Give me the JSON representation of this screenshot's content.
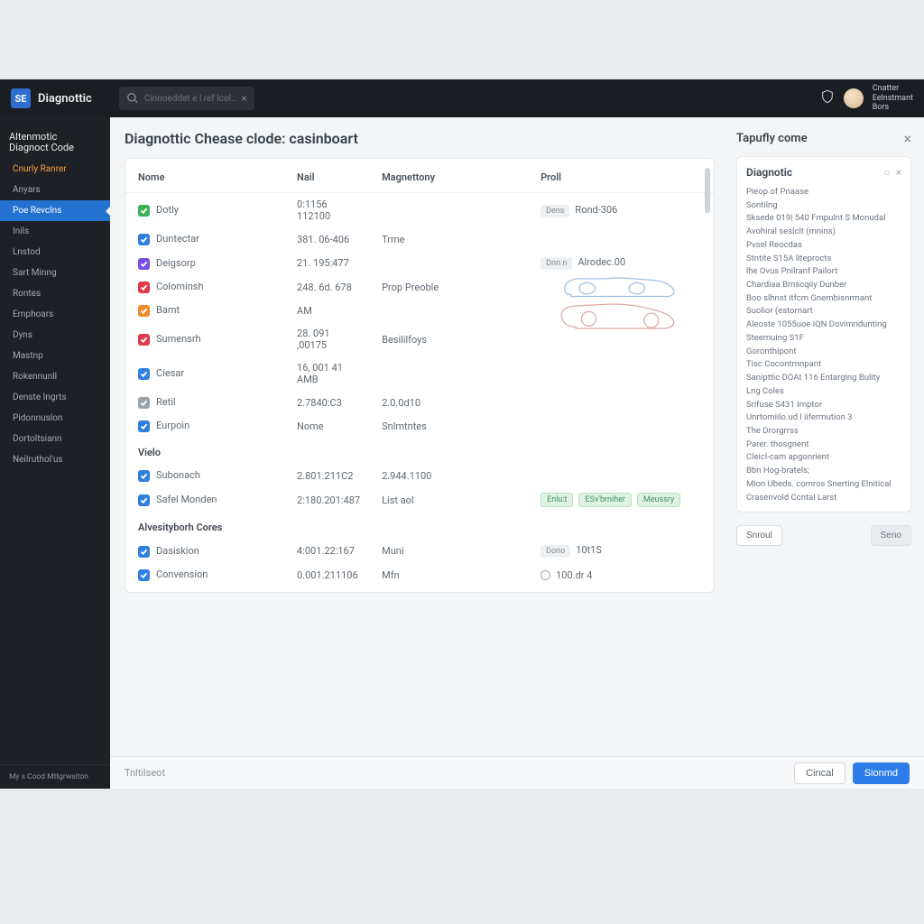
{
  "topbar": {
    "brand_tag": "SE",
    "brand_text": "Diagnottic",
    "search_placeholder": "Cinnoeddet e l ref lcol..",
    "user_line1": "Cnatter",
    "user_line2": "Eelnstmant",
    "user_line3": "Bors"
  },
  "sidebar": {
    "header1": "Altenmotic",
    "header2": "Diagnoct Code",
    "items": [
      {
        "label": "Cnurly Ranrer",
        "style": "orange"
      },
      {
        "label": "Anyars"
      },
      {
        "label": "Poe Revclns",
        "style": "active"
      },
      {
        "label": "Inils"
      },
      {
        "label": "Lnstod"
      },
      {
        "label": "Sart Minng"
      },
      {
        "label": "Rontes"
      },
      {
        "label": "Emphoars"
      },
      {
        "label": "Dyns"
      },
      {
        "label": "Mastnp"
      },
      {
        "label": "Rokennunll"
      },
      {
        "label": "Denste Ingrts"
      },
      {
        "label": "Pidonnuslon"
      },
      {
        "label": "Dortoltsiann"
      },
      {
        "label": "Neilruthol'us"
      }
    ],
    "footer": "My s Cood Mttgrwsiton"
  },
  "page": {
    "title": "Diagnottic Chease clode: casinboart",
    "columns": {
      "name": "Nome",
      "nail": "Nail",
      "magnet": "Magnettony",
      "prol": "Proll"
    },
    "rows": [
      {
        "ck": "green",
        "name": "Dotly",
        "nail": "0:1156 112100",
        "mag": "",
        "p_badge": "Dens",
        "p_text": "Rond-306"
      },
      {
        "ck": "blue",
        "name": "Duntectar",
        "nail": "381. 06-406",
        "mag": "Trme"
      },
      {
        "ck": "purple",
        "name": "Deigsorp",
        "nail": "21. 195:477",
        "mag": "",
        "p_badge": "Dnn.n",
        "p_text": "Alrodec.00"
      },
      {
        "ck": "red",
        "name": "Colominsh",
        "nail": "248. 6d. 678",
        "mag": "Prop Preoble"
      },
      {
        "ck": "orange",
        "name": "Bamt",
        "nail": "AM",
        "mag": ""
      },
      {
        "ck": "red",
        "name": "Sumensrh",
        "nail": "28. 091 ,00175",
        "mag": "Besililfoys"
      },
      {
        "ck": "blue",
        "name": "Ciesar",
        "nail": "16, 001 41 AMB",
        "mag": ""
      },
      {
        "ck": "gray",
        "name": "Retil",
        "nail": "2.7840:C3",
        "mag": "2.0.0d10"
      },
      {
        "ck": "blue",
        "name": "Eurpoin",
        "nail": "Nome",
        "mag": "Snlmtntes"
      }
    ],
    "section2_title": "Vielo",
    "rows2": [
      {
        "ck": "blue",
        "name": "Subonach",
        "nail": "2.801.211C2",
        "mag": "2.944.1100"
      },
      {
        "ck": "blue",
        "name": "Safel Monden",
        "nail": "2:180.201:487",
        "mag": "List aol",
        "p_badges": [
          "Enlu:t",
          "ESv'brniher",
          "Meussry"
        ]
      }
    ],
    "section3_title": "Alvesityborh Cores",
    "rows3": [
      {
        "ck": "blue",
        "name": "Dasiskion",
        "nail": "4:001.22:167",
        "mag": "Muni",
        "p_badge": "Dono",
        "p_text": "10t1S"
      },
      {
        "ck": "blue",
        "name": "Convension",
        "nail": "0.001.211106",
        "mag": "Mfn",
        "p_radio": true,
        "p_text": "100.dr 4"
      }
    ]
  },
  "aside": {
    "header": "Tapufly come",
    "card_title": "Diagnotic",
    "lines": [
      "Pieop of Pnaase",
      "Sontilng",
      "Sksede  019| 540 Fmpulnt S Monudal",
      "Avohiral seslclt  (mnins)",
      "Pvsel Reocdas",
      "Stntite S15A liteprocts",
      "lhe Ovus Pnilranf Pailort",
      "Chardiaa Bmscqiiy Dunber",
      "Boo slhnst itfcm Gnembisnrmant",
      "Suolior (estornart",
      "Aleoste 1055uoe iQN Dovimndunting",
      "Steemuing S1F",
      "Goronthipont",
      "Tisc Cocontrnnpant",
      "Sanipttic DOAt 116 Entarging Bulity",
      "Lng Coles",
      "Srifuse S431 Irnptor",
      "Unrtomiilo.ud l iifermution 3",
      "The Drorgrrss",
      "Parer. thosgnent",
      "Cleicl-cam apgonrient",
      "Bbn Hog-bratels;",
      "Mion Ubeds. comros Snerting Elnitical",
      "Crasenvold Ccntal Larst"
    ],
    "btn_left": "Snroul",
    "btn_right": "Seno"
  },
  "footer": {
    "label": "Tnltilseot",
    "cancel": "Cincal",
    "save": "Sionmd"
  }
}
